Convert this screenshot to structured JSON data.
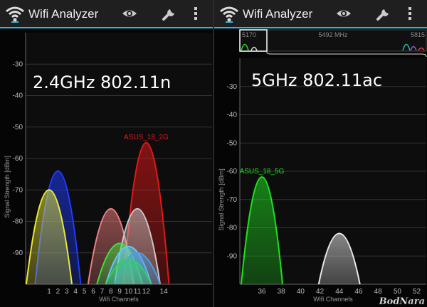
{
  "left_panel": {
    "app_title": "Wifi Analyzer",
    "band_label": "2.4GHz 802.11n",
    "chart_data": {
      "type": "area",
      "ylabel": "Signal Strength [dBm]",
      "xlabel": "Wifi Channels",
      "ylim": [
        -100,
        -20
      ],
      "yticks": [
        -30,
        -40,
        -50,
        -60,
        -70,
        -80,
        -90
      ],
      "xticks": [
        "1",
        "2",
        "3",
        "4",
        "5",
        "6",
        "7",
        "8",
        "9",
        "10",
        "11",
        "12",
        "14"
      ],
      "series": [
        {
          "name": "ASUS_18_2G",
          "channel": 12,
          "level": -55,
          "color": "#e01818",
          "label_visible": true
        },
        {
          "name": "",
          "channel": 2,
          "level": -64,
          "color": "#1e3cff",
          "label_visible": false
        },
        {
          "name": "",
          "channel": 1,
          "level": -70,
          "color": "#e8e838",
          "label_visible": false
        },
        {
          "name": "",
          "channel": 8,
          "level": -76,
          "color": "#f08080",
          "label_visible": false
        },
        {
          "name": "",
          "channel": 11,
          "level": -76,
          "color": "#c8c8c8",
          "label_visible": false
        },
        {
          "name": "",
          "channel": 9,
          "level": -87,
          "color": "#40e040",
          "label_visible": false
        },
        {
          "name": "",
          "channel": 10,
          "level": -88,
          "color": "#60c8ff",
          "label_visible": false
        },
        {
          "name": "",
          "channel": 11,
          "level": -90,
          "color": "#4aa0e8",
          "label_visible": false
        },
        {
          "name": "",
          "channel": 10,
          "level": -92,
          "color": "#30d060",
          "label_visible": false
        }
      ]
    }
  },
  "right_panel": {
    "app_title": "Wifi Analyzer",
    "band_label": "5GHz 802.11ac",
    "overview": {
      "left_label": "5170",
      "mid_label": "5492 MHz",
      "right_label": "5815"
    },
    "chart_data": {
      "type": "area",
      "ylabel": "Signal Strength [dBm]",
      "xlabel": "Wifi Channels",
      "ylim": [
        -100,
        -20
      ],
      "yticks": [
        -30,
        -40,
        -50,
        -60,
        -70,
        -80,
        -90
      ],
      "xticks": [
        "36",
        "38",
        "40",
        "42",
        "44",
        "46",
        "48",
        "50",
        "52"
      ],
      "series": [
        {
          "name": "ASUS_18_5G",
          "channel": 36,
          "level": -62,
          "color": "#20e020",
          "label_visible": true
        },
        {
          "name": "",
          "channel": 44,
          "level": -82,
          "color": "#e8e8e8",
          "label_visible": false
        }
      ]
    }
  },
  "watermark": "BodNara"
}
